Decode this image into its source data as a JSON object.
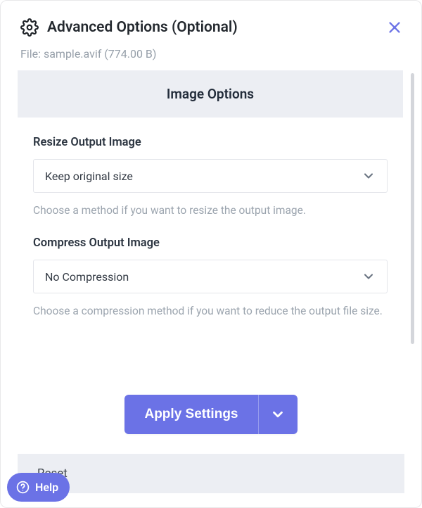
{
  "header": {
    "title": "Advanced Options (Optional)"
  },
  "file": {
    "label": "File:",
    "name": "sample.avif",
    "size": "(774.00 B)"
  },
  "section_title": "Image Options",
  "resize": {
    "label": "Resize Output Image",
    "selected": "Keep original size",
    "help": "Choose a method if you want to resize the output image."
  },
  "compress": {
    "label": "Compress Output Image",
    "selected": "No Compression",
    "help": "Choose a compression method if you want to reduce the output file size."
  },
  "actions": {
    "apply": "Apply Settings",
    "reset": "Reset"
  },
  "help_bubble": "Help"
}
